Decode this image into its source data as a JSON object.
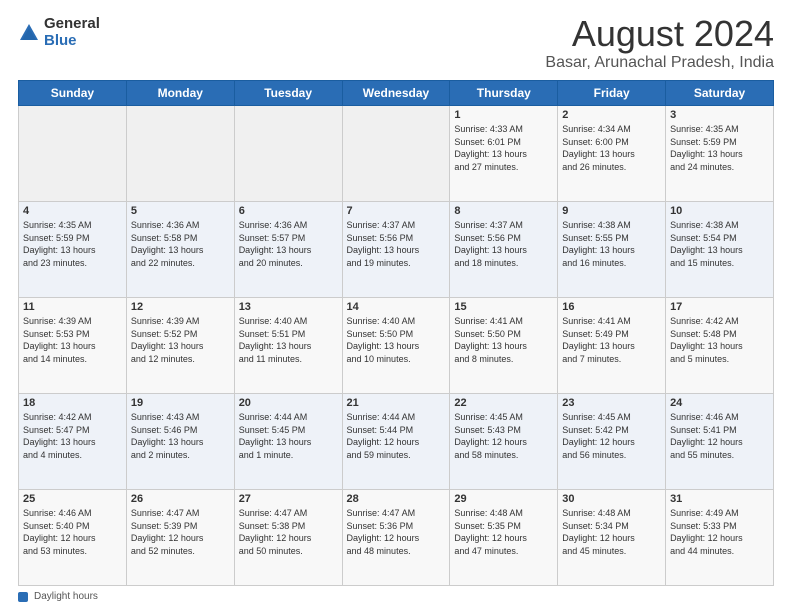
{
  "header": {
    "logo_general": "General",
    "logo_blue": "Blue",
    "title": "August 2024",
    "subtitle": "Basar, Arunachal Pradesh, India"
  },
  "days_of_week": [
    "Sunday",
    "Monday",
    "Tuesday",
    "Wednesday",
    "Thursday",
    "Friday",
    "Saturday"
  ],
  "weeks": [
    [
      {
        "day": "",
        "info": ""
      },
      {
        "day": "",
        "info": ""
      },
      {
        "day": "",
        "info": ""
      },
      {
        "day": "",
        "info": ""
      },
      {
        "day": "1",
        "info": "Sunrise: 4:33 AM\nSunset: 6:01 PM\nDaylight: 13 hours\nand 27 minutes."
      },
      {
        "day": "2",
        "info": "Sunrise: 4:34 AM\nSunset: 6:00 PM\nDaylight: 13 hours\nand 26 minutes."
      },
      {
        "day": "3",
        "info": "Sunrise: 4:35 AM\nSunset: 5:59 PM\nDaylight: 13 hours\nand 24 minutes."
      }
    ],
    [
      {
        "day": "4",
        "info": "Sunrise: 4:35 AM\nSunset: 5:59 PM\nDaylight: 13 hours\nand 23 minutes."
      },
      {
        "day": "5",
        "info": "Sunrise: 4:36 AM\nSunset: 5:58 PM\nDaylight: 13 hours\nand 22 minutes."
      },
      {
        "day": "6",
        "info": "Sunrise: 4:36 AM\nSunset: 5:57 PM\nDaylight: 13 hours\nand 20 minutes."
      },
      {
        "day": "7",
        "info": "Sunrise: 4:37 AM\nSunset: 5:56 PM\nDaylight: 13 hours\nand 19 minutes."
      },
      {
        "day": "8",
        "info": "Sunrise: 4:37 AM\nSunset: 5:56 PM\nDaylight: 13 hours\nand 18 minutes."
      },
      {
        "day": "9",
        "info": "Sunrise: 4:38 AM\nSunset: 5:55 PM\nDaylight: 13 hours\nand 16 minutes."
      },
      {
        "day": "10",
        "info": "Sunrise: 4:38 AM\nSunset: 5:54 PM\nDaylight: 13 hours\nand 15 minutes."
      }
    ],
    [
      {
        "day": "11",
        "info": "Sunrise: 4:39 AM\nSunset: 5:53 PM\nDaylight: 13 hours\nand 14 minutes."
      },
      {
        "day": "12",
        "info": "Sunrise: 4:39 AM\nSunset: 5:52 PM\nDaylight: 13 hours\nand 12 minutes."
      },
      {
        "day": "13",
        "info": "Sunrise: 4:40 AM\nSunset: 5:51 PM\nDaylight: 13 hours\nand 11 minutes."
      },
      {
        "day": "14",
        "info": "Sunrise: 4:40 AM\nSunset: 5:50 PM\nDaylight: 13 hours\nand 10 minutes."
      },
      {
        "day": "15",
        "info": "Sunrise: 4:41 AM\nSunset: 5:50 PM\nDaylight: 13 hours\nand 8 minutes."
      },
      {
        "day": "16",
        "info": "Sunrise: 4:41 AM\nSunset: 5:49 PM\nDaylight: 13 hours\nand 7 minutes."
      },
      {
        "day": "17",
        "info": "Sunrise: 4:42 AM\nSunset: 5:48 PM\nDaylight: 13 hours\nand 5 minutes."
      }
    ],
    [
      {
        "day": "18",
        "info": "Sunrise: 4:42 AM\nSunset: 5:47 PM\nDaylight: 13 hours\nand 4 minutes."
      },
      {
        "day": "19",
        "info": "Sunrise: 4:43 AM\nSunset: 5:46 PM\nDaylight: 13 hours\nand 2 minutes."
      },
      {
        "day": "20",
        "info": "Sunrise: 4:44 AM\nSunset: 5:45 PM\nDaylight: 13 hours\nand 1 minute."
      },
      {
        "day": "21",
        "info": "Sunrise: 4:44 AM\nSunset: 5:44 PM\nDaylight: 12 hours\nand 59 minutes."
      },
      {
        "day": "22",
        "info": "Sunrise: 4:45 AM\nSunset: 5:43 PM\nDaylight: 12 hours\nand 58 minutes."
      },
      {
        "day": "23",
        "info": "Sunrise: 4:45 AM\nSunset: 5:42 PM\nDaylight: 12 hours\nand 56 minutes."
      },
      {
        "day": "24",
        "info": "Sunrise: 4:46 AM\nSunset: 5:41 PM\nDaylight: 12 hours\nand 55 minutes."
      }
    ],
    [
      {
        "day": "25",
        "info": "Sunrise: 4:46 AM\nSunset: 5:40 PM\nDaylight: 12 hours\nand 53 minutes."
      },
      {
        "day": "26",
        "info": "Sunrise: 4:47 AM\nSunset: 5:39 PM\nDaylight: 12 hours\nand 52 minutes."
      },
      {
        "day": "27",
        "info": "Sunrise: 4:47 AM\nSunset: 5:38 PM\nDaylight: 12 hours\nand 50 minutes."
      },
      {
        "day": "28",
        "info": "Sunrise: 4:47 AM\nSunset: 5:36 PM\nDaylight: 12 hours\nand 48 minutes."
      },
      {
        "day": "29",
        "info": "Sunrise: 4:48 AM\nSunset: 5:35 PM\nDaylight: 12 hours\nand 47 minutes."
      },
      {
        "day": "30",
        "info": "Sunrise: 4:48 AM\nSunset: 5:34 PM\nDaylight: 12 hours\nand 45 minutes."
      },
      {
        "day": "31",
        "info": "Sunrise: 4:49 AM\nSunset: 5:33 PM\nDaylight: 12 hours\nand 44 minutes."
      }
    ]
  ],
  "footer": {
    "label": "Daylight hours"
  }
}
